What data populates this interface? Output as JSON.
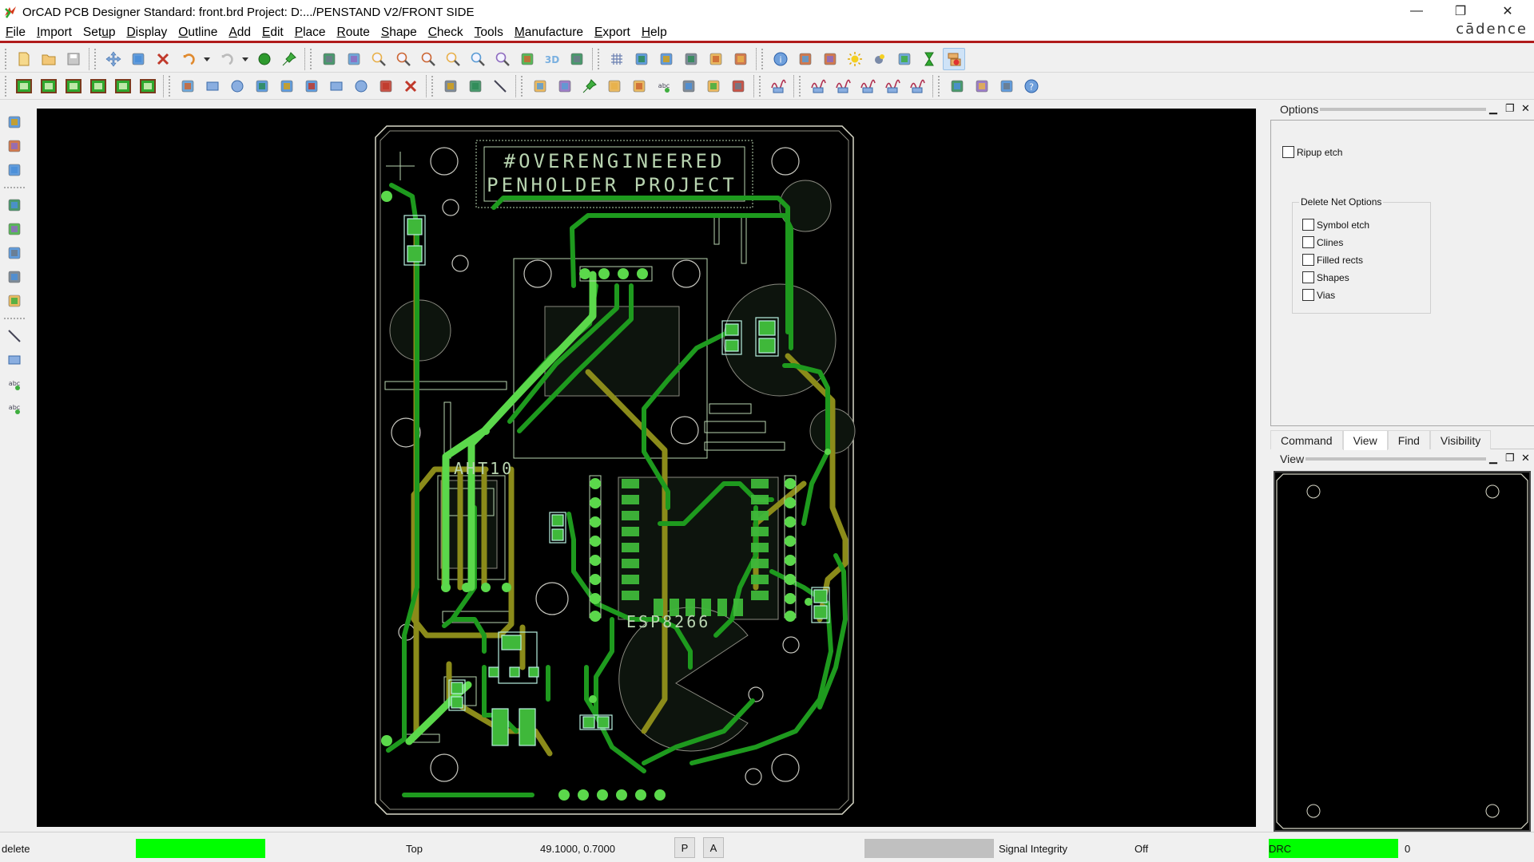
{
  "window": {
    "title": "OrCAD PCB Designer Standard: front.brd  Project: D:.../PENSTAND V2/FRONT SIDE",
    "minimize_label": "—",
    "restore_label": "❐",
    "close_label": "✕",
    "brand": "cādence"
  },
  "menu": [
    {
      "label": "File",
      "mnemonic": "F"
    },
    {
      "label": "Import",
      "mnemonic": "I"
    },
    {
      "label": "Setup",
      "mnemonic": "u"
    },
    {
      "label": "Display",
      "mnemonic": "D"
    },
    {
      "label": "Outline",
      "mnemonic": "O"
    },
    {
      "label": "Add",
      "mnemonic": "A"
    },
    {
      "label": "Edit",
      "mnemonic": "E"
    },
    {
      "label": "Place",
      "mnemonic": "P"
    },
    {
      "label": "Route",
      "mnemonic": "R"
    },
    {
      "label": "Shape",
      "mnemonic": "S"
    },
    {
      "label": "Check",
      "mnemonic": "C"
    },
    {
      "label": "Tools",
      "mnemonic": "T"
    },
    {
      "label": "Manufacture",
      "mnemonic": "M"
    },
    {
      "label": "Export",
      "mnemonic": "E"
    },
    {
      "label": "Help",
      "mnemonic": "H"
    }
  ],
  "toolbar1": {
    "groups": [
      [
        "new-icon",
        "open-icon",
        "save-icon"
      ],
      [
        "move-icon",
        "copy-icon",
        "delete-icon",
        "undo-icon",
        "undo-dropdown-icon",
        "redo-icon",
        "redo-dropdown-icon",
        "fix-icon",
        "pin-icon"
      ],
      [
        "unrats-all-icon",
        "rats-all-icon",
        "zoom-points-icon",
        "zoom-fit-icon",
        "zoom-in-icon",
        "zoom-out-icon",
        "zoom-previous-icon",
        "zoom-world-icon",
        "refresh-icon",
        "3d-view-icon",
        "flip-board-icon"
      ],
      [
        "grid-toggle-icon",
        "color-dialog-icon",
        "shadow-mode-icon",
        "xsection-icon",
        "constraint-manager-icon",
        "globe-icon"
      ],
      [
        "info-icon",
        "property-icon",
        "measure-icon",
        "highlight-icon",
        "dehighlight-icon",
        "assign-color-icon",
        "drc-update-icon",
        "delete-unconnected-icon"
      ]
    ],
    "active": "delete-unconnected-icon"
  },
  "toolbar2": {
    "groups": [
      [
        "etch-edit-1-icon",
        "etch-edit-2-icon",
        "etch-edit-3-icon",
        "etch-edit-4-icon",
        "etch-edit-5-icon",
        "etch-edit-6-icon"
      ],
      [
        "shape-poly-icon",
        "shape-rect-icon",
        "shape-circle-icon",
        "shape-select-icon",
        "shape-merge-icon",
        "shape-void-icon",
        "shape-void-rect-icon",
        "shape-void-circle-icon",
        "shape-edit-boundary-icon",
        "shape-delete-island-icon"
      ],
      [
        "design-rules-icon",
        "dimension-icon",
        "dimension-linear-icon"
      ],
      [
        "place-manual-icon",
        "swap-components-icon",
        "swap-pins-icon",
        "component-icon",
        "renumber-icon",
        "edit-text-icon",
        "drill-icon",
        "array-icon",
        "array-2-icon"
      ],
      [
        "waveform-icon"
      ],
      [
        "si-1-icon",
        "si-2-icon",
        "si-3-icon",
        "si-4-icon",
        "si-5-icon"
      ],
      [
        "report-icon",
        "net-schedule-icon",
        "topology-icon",
        "help-icon"
      ]
    ]
  },
  "left_toolbar": {
    "groups": [
      [
        "place-components-icon",
        "place-symbol-icon",
        "swap-icon"
      ],
      [
        "add-connect-icon",
        "slide-icon",
        "custom-smooth-icon",
        "delay-tune-icon",
        "phase-tune-icon"
      ],
      [
        "add-line-icon",
        "add-rect-icon",
        "add-text-icon",
        "edit-text-icon"
      ]
    ]
  },
  "pcb": {
    "silk_title_line1": "#OVERENGINEERED",
    "silk_title_line2": "PENHOLDER PROJECT",
    "label_sensor": "AHT10",
    "label_mcu": "ESP8266",
    "colors": {
      "background": "#000000",
      "outline": "#d8d8c8",
      "top_etch": "#1e9a1e",
      "top_etch_bright": "#5bd84b",
      "bottom_etch": "#8b8b1a",
      "silk": "#b8d4b0"
    }
  },
  "options_panel": {
    "title": "Options",
    "ripup_etch": {
      "label": "Ripup etch",
      "checked": false
    },
    "delete_net_options": {
      "legend": "Delete Net Options",
      "items": [
        {
          "label": "Symbol etch",
          "checked": false
        },
        {
          "label": "Clines",
          "checked": false
        },
        {
          "label": "Filled rects",
          "checked": false
        },
        {
          "label": "Shapes",
          "checked": false
        },
        {
          "label": "Vias",
          "checked": false
        }
      ]
    }
  },
  "tabs": [
    {
      "label": "Command",
      "selected": false
    },
    {
      "label": "View",
      "selected": true
    },
    {
      "label": "Find",
      "selected": false
    },
    {
      "label": "Visibility",
      "selected": false
    }
  ],
  "view_panel": {
    "title": "View"
  },
  "status": {
    "command": "delete",
    "command_indicator_color": "#00ff00",
    "active_layer": "Top",
    "coordinates": "49.1000, 0.7000",
    "p_button": "P",
    "a_button": "A",
    "si_label": "Signal Integrity",
    "si_value": "Off",
    "drc_label": "DRC",
    "drc_color": "#00ff00",
    "drc_count": "0"
  }
}
